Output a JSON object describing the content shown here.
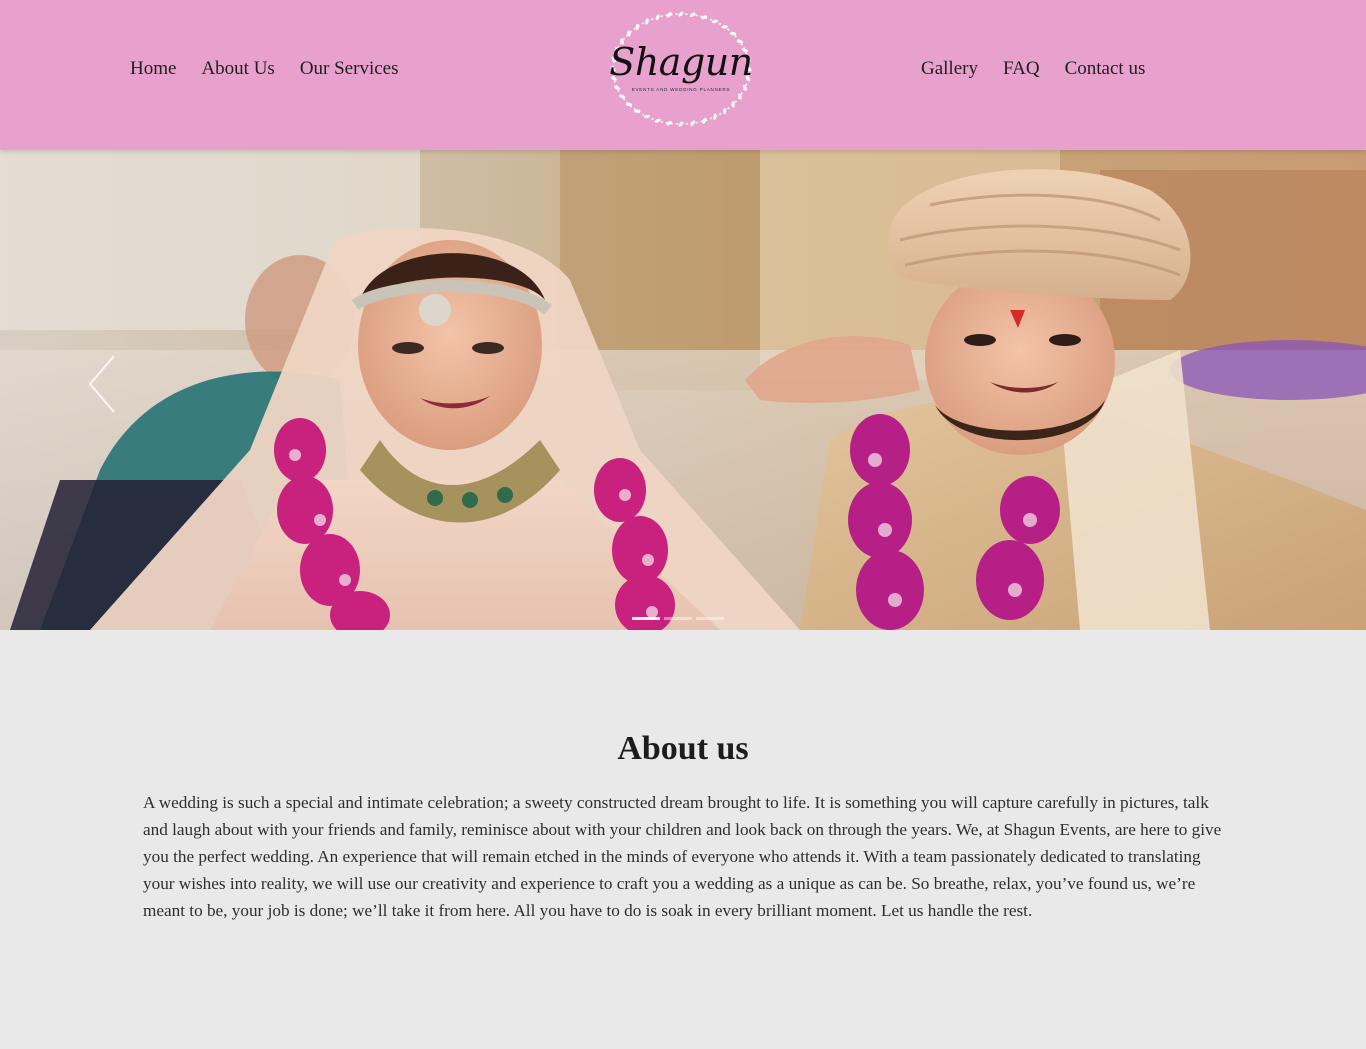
{
  "nav": {
    "left": [
      "Home",
      "About Us",
      "Our Services"
    ],
    "right": [
      "Gallery",
      "FAQ",
      "Contact us"
    ]
  },
  "logo": {
    "name": "Shagun",
    "tagline": "EVENTS AND WEDDING PLANNERS"
  },
  "hero": {
    "slides": 3,
    "active_slide": 1,
    "prev_icon": "chevron-left-icon"
  },
  "about": {
    "title": "About us",
    "body": "A wedding is such a special and intimate celebration; a sweety constructed dream brought to life. It is something you will capture carefully in pictures, talk and laugh about with your friends and family, reminisce about with your children and look back on through the years. We, at Shagun Events, are here to give you the perfect wedding. An experience that will remain etched in the minds of everyone who attends it. With a team passionately dedicated to translating your wishes into reality, we will use our creativity and experience to craft you a wedding as a unique as can be. So breathe, relax, you’ve found us, we’re meant to be, your job is done; we’ll take it from here. All you have to do is soak in every brilliant moment. Let us handle the rest."
  },
  "colors": {
    "header_bg": "#e8a1cc",
    "page_bg": "#e9e9e9",
    "text": "#222222"
  }
}
